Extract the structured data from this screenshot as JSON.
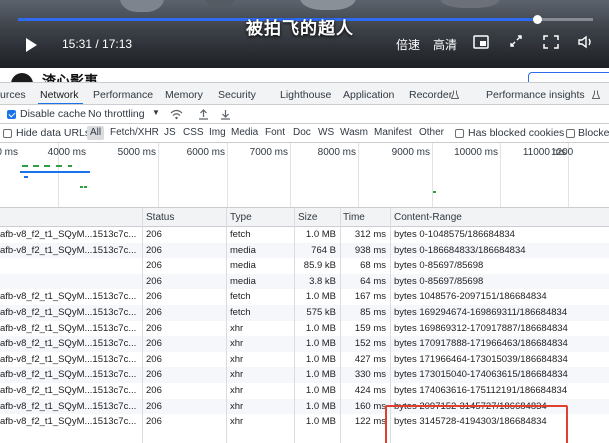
{
  "player": {
    "subtitle": "被拍飞的超人",
    "time": "15:31 / 17:13",
    "progress_fraction": 0.902,
    "speed_label": "倍速",
    "quality_label": "高清",
    "icons": [
      "play-icon",
      "pip-icon",
      "fullscreen-web-icon",
      "fullscreen-icon",
      "volume-icon"
    ]
  },
  "channel": {
    "name": "渣心影事"
  },
  "devtools": {
    "tabs": [
      "urces",
      "Network",
      "Performance",
      "Memory",
      "Security",
      "Lighthouse",
      "Application",
      "Recorder",
      "Performance insights"
    ],
    "active_tab": "Network",
    "accent": "#1a73e8",
    "toolbar": {
      "disable_cache": "Disable cache",
      "disable_cache_checked": true,
      "throttling": "No throttling"
    },
    "filters": {
      "hide_data_urls": "Hide data URLs",
      "types": [
        "All",
        "Fetch/XHR",
        "JS",
        "CSS",
        "Img",
        "Media",
        "Font",
        "Doc",
        "WS",
        "Wasm",
        "Manifest",
        "Other"
      ],
      "selected": "All",
      "has_blocked_cookies": "Has blocked cookies",
      "blocked": "Blocked"
    },
    "overview_ticks": [
      "0 ms",
      "4000 ms",
      "5000 ms",
      "6000 ms",
      "7000 ms",
      "8000 ms",
      "9000 ms",
      "10000 ms",
      "11000 ms",
      "1200"
    ],
    "columns": {
      "name": "",
      "status": "Status",
      "type": "Type",
      "size": "Size",
      "time": "Time",
      "range": "Content-Range"
    },
    "rows": [
      {
        "name": "afb-v8_f2_t1_SQyM...1513c7c...",
        "status": "206",
        "type": "fetch",
        "size": "1.0 MB",
        "time": "312 ms",
        "range": "bytes 0-1048575/186684834"
      },
      {
        "name": "afb-v8_f2_t1_SQyM...1513c7c...",
        "status": "206",
        "type": "media",
        "size": "764 B",
        "time": "938 ms",
        "range": "bytes 0-186684833/186684834"
      },
      {
        "name": "",
        "status": "206",
        "type": "media",
        "size": "85.9 kB",
        "time": "68 ms",
        "range": "bytes 0-85697/85698"
      },
      {
        "name": "",
        "status": "206",
        "type": "media",
        "size": "3.8 kB",
        "time": "64 ms",
        "range": "bytes 0-85697/85698"
      },
      {
        "name": "afb-v8_f2_t1_SQyM...1513c7c...",
        "status": "206",
        "type": "fetch",
        "size": "1.0 MB",
        "time": "167 ms",
        "range": "bytes 1048576-2097151/186684834"
      },
      {
        "name": "afb-v8_f2_t1_SQyM...1513c7c...",
        "status": "206",
        "type": "fetch",
        "size": "575 kB",
        "time": "85 ms",
        "range": "bytes 169294674-169869311/186684834"
      },
      {
        "name": "afb-v8_f2_t1_SQyM...1513c7c...",
        "status": "206",
        "type": "xhr",
        "size": "1.0 MB",
        "time": "159 ms",
        "range": "bytes 169869312-170917887/186684834"
      },
      {
        "name": "afb-v8_f2_t1_SQyM...1513c7c...",
        "status": "206",
        "type": "xhr",
        "size": "1.0 MB",
        "time": "152 ms",
        "range": "bytes 170917888-171966463/186684834"
      },
      {
        "name": "afb-v8_f2_t1_SQyM...1513c7c...",
        "status": "206",
        "type": "xhr",
        "size": "1.0 MB",
        "time": "427 ms",
        "range": "bytes 171966464-173015039/186684834"
      },
      {
        "name": "afb-v8_f2_t1_SQyM...1513c7c...",
        "status": "206",
        "type": "xhr",
        "size": "1.0 MB",
        "time": "330 ms",
        "range": "bytes 173015040-174063615/186684834"
      },
      {
        "name": "afb-v8_f2_t1_SQyM...1513c7c...",
        "status": "206",
        "type": "xhr",
        "size": "1.0 MB",
        "time": "424 ms",
        "range": "bytes 174063616-175112191/186684834"
      },
      {
        "name": "afb-v8_f2_t1_SQyM...1513c7c...",
        "status": "206",
        "type": "xhr",
        "size": "1.0 MB",
        "time": "160 ms",
        "range": "bytes 2097152-3145727/186684834"
      },
      {
        "name": "afb-v8_f2_t1_SQyM...1513c7c...",
        "status": "206",
        "type": "xhr",
        "size": "1.0 MB",
        "time": "122 ms",
        "range": "bytes 3145728-4194303/186684834"
      }
    ],
    "highlight_color": "#e0412e"
  }
}
